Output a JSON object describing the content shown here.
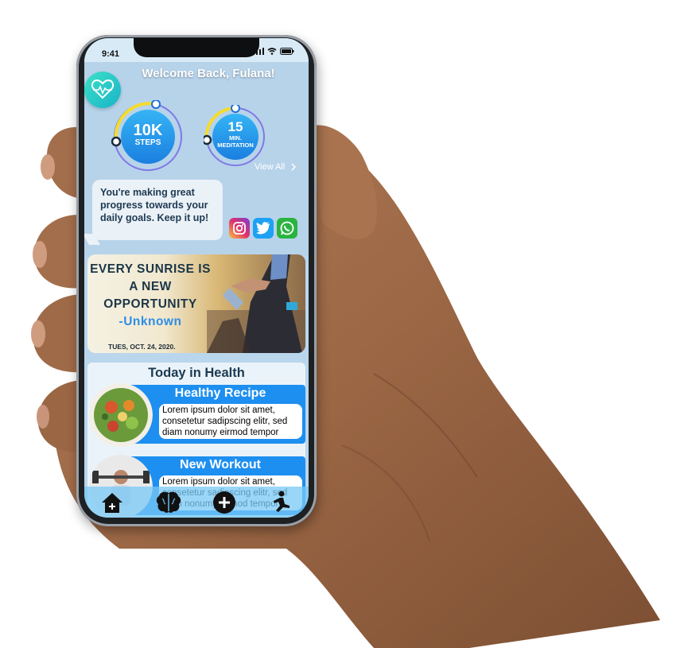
{
  "status": {
    "time": "9:41"
  },
  "header": {
    "welcome": "Welcome Back, Fulana!",
    "view_all": "View All"
  },
  "stats": [
    {
      "value": "10K",
      "unit": "STEPS"
    },
    {
      "value": "15",
      "unit": "MIN. MEDITATION"
    }
  ],
  "message": "You're making great progress towards your daily goals. Keep it up!",
  "quote": {
    "line1": "EVERY SUNRISE IS",
    "line2": "A NEW",
    "line3": "OPPORTUNITY",
    "author": "-Unknown",
    "date": "TUES, OCT. 24, 2020."
  },
  "health": {
    "title": "Today in Health",
    "cards": [
      {
        "title": "Healthy Recipe",
        "body": "Lorem ipsum dolor sit amet, consetetur sadipscing elitr, sed diam nonumy eirmod tempor"
      },
      {
        "title": "New Workout",
        "body": "Lorem ipsum dolor sit amet, consetetur sadipscing elitr, sed diam nonumy eirmod tempor"
      }
    ]
  },
  "icons": {
    "heart": "heart-pulse-icon",
    "social": [
      "instagram-icon",
      "twitter-icon",
      "whatsapp-icon"
    ],
    "nav": [
      "home-icon",
      "brain-icon",
      "add-icon",
      "exercise-icon"
    ]
  },
  "colors": {
    "accent": "#1d8ff0",
    "teal": "#2fd0c8",
    "screen_bg": "#b7d3ea"
  }
}
